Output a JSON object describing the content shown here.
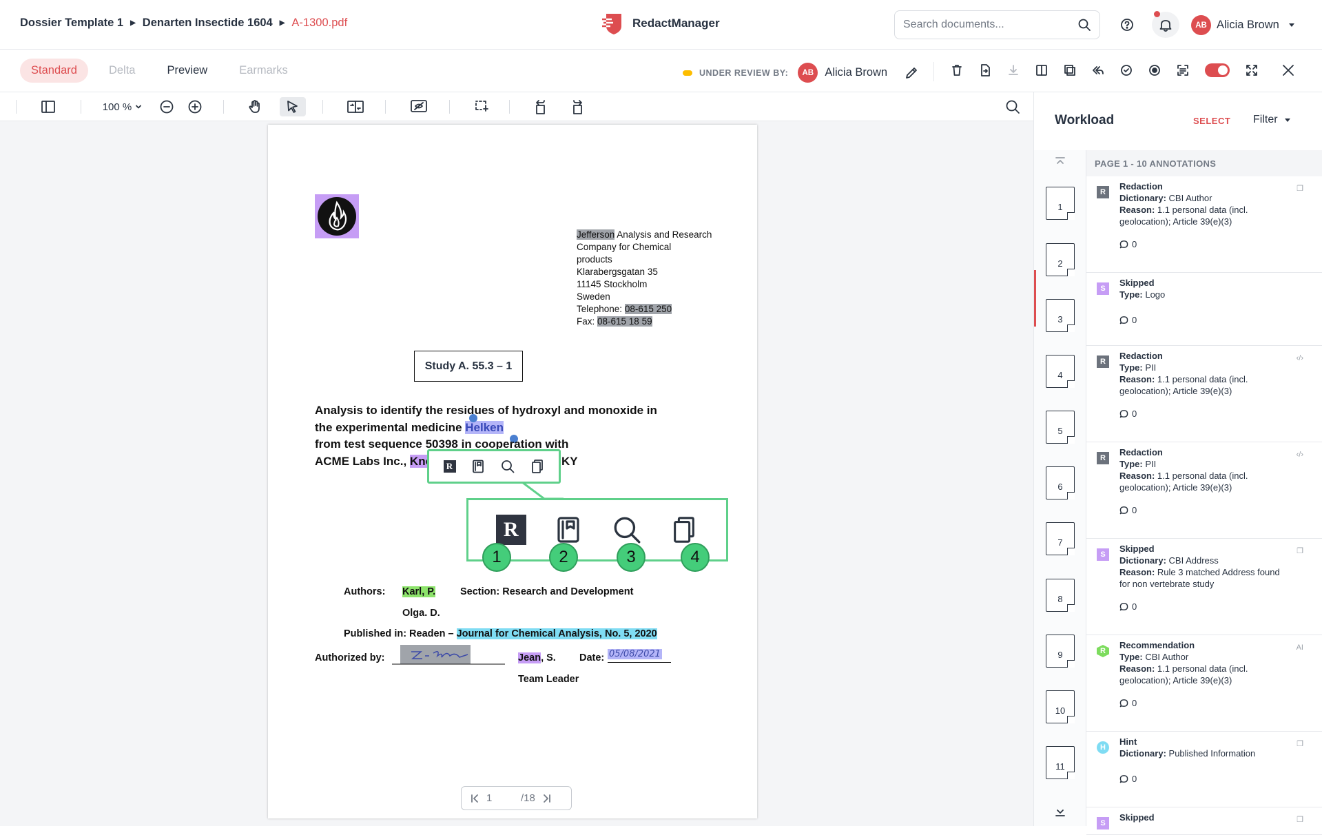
{
  "breadcrumbs": [
    {
      "label": "Dossier Template 1"
    },
    {
      "label": "Denarten Insectide 1604"
    },
    {
      "label": "A-1300.pdf"
    }
  ],
  "app": {
    "name": "RedactManager"
  },
  "search": {
    "placeholder": "Search documents..."
  },
  "user": {
    "initials": "AB",
    "name": "Alicia Brown"
  },
  "tabs": [
    {
      "label": "Standard",
      "state": "active"
    },
    {
      "label": "Delta",
      "state": "disabled"
    },
    {
      "label": "Preview",
      "state": "normal"
    },
    {
      "label": "Earmarks",
      "state": "disabled"
    }
  ],
  "review": {
    "label": "UNDER REVIEW BY:",
    "initials": "AB",
    "user": "Alicia Brown"
  },
  "pdf_toolbar": {
    "zoom": "100 %"
  },
  "document": {
    "address_lines": [
      {
        "parts": [
          {
            "t": "Jefferson",
            "hl": "gray"
          },
          {
            "t": " Analysis and Research"
          }
        ]
      },
      {
        "parts": [
          {
            "t": "Company for Chemical"
          }
        ]
      },
      {
        "parts": [
          {
            "t": "products"
          }
        ]
      },
      {
        "parts": [
          {
            "t": "Klarabergsgatan 35"
          }
        ]
      },
      {
        "parts": [
          {
            "t": "11145 Stockholm"
          }
        ]
      },
      {
        "parts": [
          {
            "t": "Sweden"
          }
        ]
      },
      {
        "parts": [
          {
            "t": "Telephone: "
          },
          {
            "t": "08-615 250",
            "hl": "gray"
          }
        ]
      },
      {
        "parts": [
          {
            "t": "Fax: "
          },
          {
            "t": "08-615 18 59",
            "hl": "gray"
          }
        ]
      }
    ],
    "study": "Study A. 55.3 – 1",
    "title_1": "Analysis to identify the residues of hydroxyl and monoxide in",
    "title_2a": "the experimental medicine ",
    "title_2b": "Helken",
    "title_3": "from test sequence 50398 in cooperation with",
    "title_4a": "ACME Labs Inc., ",
    "title_4b": "Kno",
    "title_4c": "KY",
    "authors_label": "Authors:",
    "author_1": "Karl, P.",
    "section": "Section: Research and Development",
    "author_2": "Olga. D.",
    "published_label": "Published in: Readen – ",
    "journal": "Journal for Chemical Analysis, No. 5, 2020",
    "authorized_label": "Authorized by:",
    "signer_a": "Jean",
    "signer_b": ", S.",
    "date_label": "Date:",
    "date_value": "05/08/2021",
    "team_leader": "Team Leader"
  },
  "callout_badges": [
    "1",
    "2",
    "3",
    "4"
  ],
  "pager": {
    "current": "1",
    "total": "/18"
  },
  "workload": {
    "title": "Workload",
    "select": "SELECT",
    "filter": "Filter",
    "page_header": "PAGE 1 - 10 ANNOTATIONS",
    "pages": [
      "1",
      "2",
      "3",
      "4",
      "5",
      "6",
      "7",
      "8",
      "9",
      "10",
      "11"
    ],
    "annotations": [
      {
        "icon": "R",
        "kind": "r",
        "type": "Redaction",
        "l1": "Dictionary:",
        "v1": "CBI Author",
        "l2": "Reason:",
        "v2": "1.1 personal data (incl. geolocation); Article 39(e)(3)",
        "comments": "0",
        "corner": "❐"
      },
      {
        "icon": "S",
        "kind": "s",
        "type": "Skipped",
        "l1": "Type:",
        "v1": "Logo",
        "l2": "",
        "v2": "",
        "comments": "0",
        "corner": ""
      },
      {
        "icon": "R",
        "kind": "r",
        "type": "Redaction",
        "l1": "Type:",
        "v1": "PII",
        "l2": "Reason:",
        "v2": "1.1 personal data (incl. geolocation); Article 39(e)(3)",
        "comments": "0",
        "corner": "‹/›"
      },
      {
        "icon": "R",
        "kind": "r",
        "type": "Redaction",
        "l1": "Type:",
        "v1": "PII",
        "l2": "Reason:",
        "v2": "1.1 personal data (incl. geolocation); Article 39(e)(3)",
        "comments": "0",
        "corner": "‹/›"
      },
      {
        "icon": "S",
        "kind": "s",
        "type": "Skipped",
        "l1": "Dictionary:",
        "v1": "CBI Address",
        "l2": "Reason:",
        "v2": "Rule 3 matched Address found for non vertebrate study",
        "comments": "0",
        "corner": "❐"
      },
      {
        "icon": "R",
        "kind": "rec",
        "type": "Recommendation",
        "l1": "Type:",
        "v1": "CBI Author",
        "l2": "Reason:",
        "v2": "1.1 personal data (incl. geolocation); Article 39(e)(3)",
        "comments": "0",
        "corner": "AI"
      },
      {
        "icon": "H",
        "kind": "h",
        "type": "Hint",
        "l1": "Dictionary:",
        "v1": "Published Information",
        "l2": "",
        "v2": "",
        "comments": "0",
        "corner": "❐"
      },
      {
        "icon": "S",
        "kind": "s",
        "type": "Skipped",
        "l1": "",
        "v1": "",
        "l2": "",
        "v2": "",
        "comments": "",
        "corner": "❐"
      }
    ]
  }
}
